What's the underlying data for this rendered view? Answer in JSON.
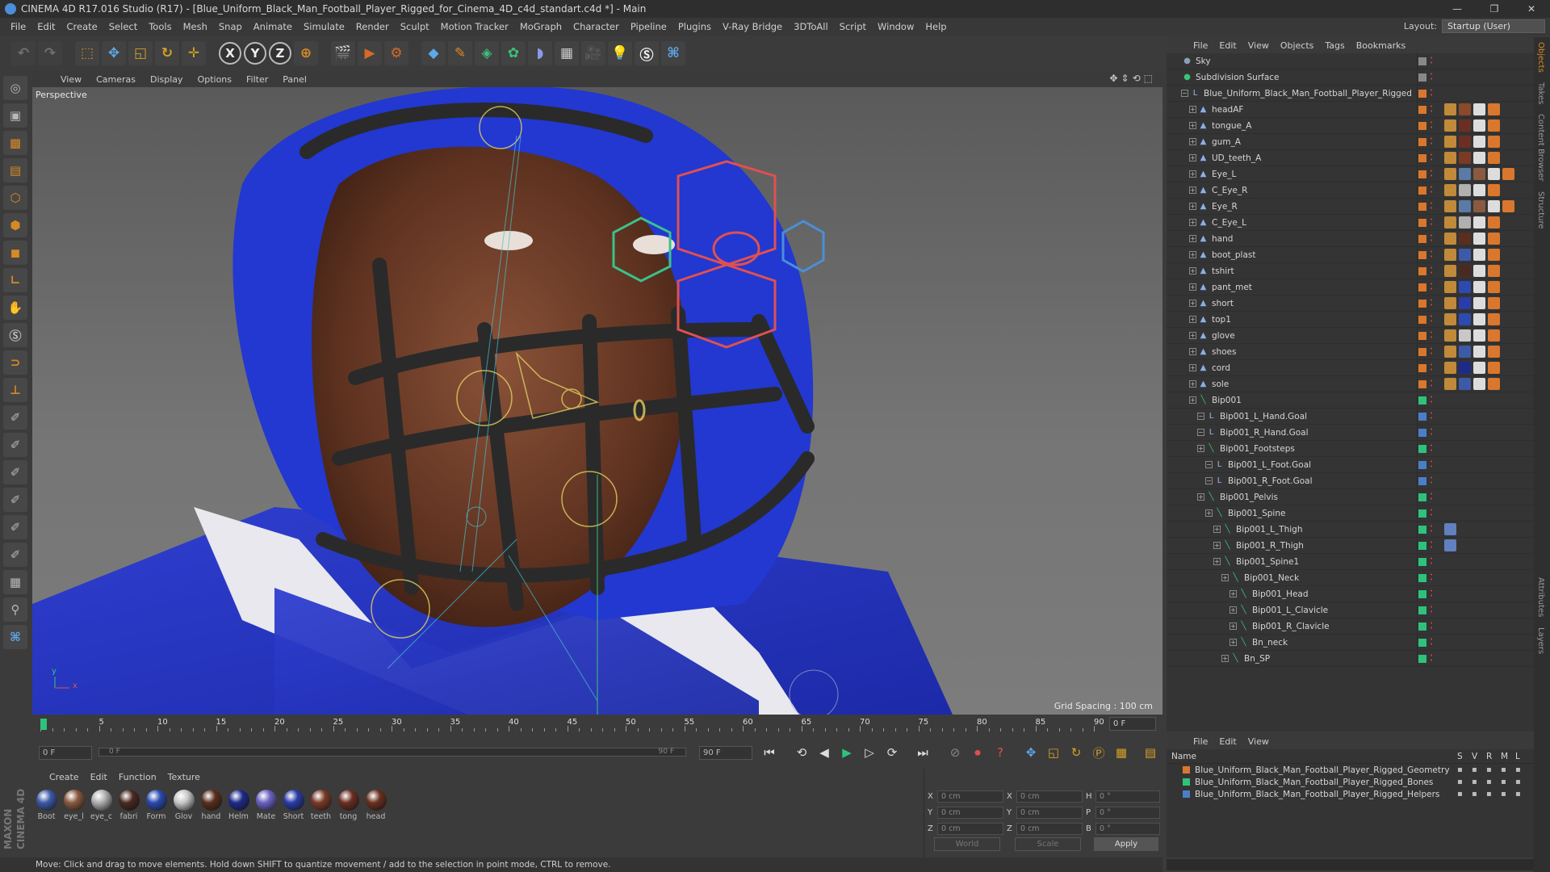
{
  "window": {
    "title": "CINEMA 4D R17.016 Studio (R17) - [Blue_Uniform_Black_Man_Football_Player_Rigged_for_Cinema_4D_c4d_standart.c4d *] - Main",
    "minimize": "—",
    "maximize": "❐",
    "close": "✕"
  },
  "menu": [
    "File",
    "Edit",
    "Create",
    "Select",
    "Tools",
    "Mesh",
    "Snap",
    "Animate",
    "Simulate",
    "Render",
    "Sculpt",
    "Motion Tracker",
    "MoGraph",
    "Character",
    "Pipeline",
    "Plugins",
    "V-Ray Bridge",
    "3DToAll",
    "Script",
    "Window",
    "Help"
  ],
  "layout": {
    "label": "Layout:",
    "value": "Startup (User)"
  },
  "toolbar": {
    "axis_x": "X",
    "axis_y": "Y",
    "axis_z": "Z"
  },
  "viewport": {
    "menu": [
      "View",
      "Cameras",
      "Display",
      "Options",
      "Filter",
      "Panel"
    ],
    "label": "Perspective",
    "grid_spacing": "Grid Spacing : 100 cm",
    "axis_y": "y",
    "axis_x": "x"
  },
  "timeline": {
    "ticks": [
      "0",
      "5",
      "10",
      "15",
      "20",
      "25",
      "30",
      "35",
      "40",
      "45",
      "50",
      "55",
      "60",
      "65",
      "70",
      "75",
      "80",
      "85",
      "90"
    ],
    "current": "0 F"
  },
  "transport": {
    "start": "0 F",
    "slider_start": "0 F",
    "slider_end": "90 F",
    "end": "90 F"
  },
  "material_menu": [
    "Create",
    "Edit",
    "Function",
    "Texture"
  ],
  "materials": [
    {
      "name": "Boot",
      "color": "#3d5aa8"
    },
    {
      "name": "eye_l",
      "color": "#8a5a40"
    },
    {
      "name": "eye_c",
      "color": "#b0b0b0"
    },
    {
      "name": "fabri",
      "color": "#4a2a20"
    },
    {
      "name": "Form",
      "color": "#2c4ab0"
    },
    {
      "name": "Glov",
      "color": "#c8c8c8"
    },
    {
      "name": "hand",
      "color": "#5a2e1e"
    },
    {
      "name": "Helm",
      "color": "#1e2a8a"
    },
    {
      "name": "Mate",
      "color": "#6a62c0"
    },
    {
      "name": "Short",
      "color": "#2a3ca8"
    },
    {
      "name": "teeth",
      "color": "#7a3a26"
    },
    {
      "name": "tong",
      "color": "#6a2e22"
    },
    {
      "name": "head",
      "color": "#6a3020"
    }
  ],
  "coords": {
    "x_pos": "0 cm",
    "y_pos": "0 cm",
    "z_pos": "0 cm",
    "x_size": "0 cm",
    "y_size": "0 cm",
    "z_size": "0 cm",
    "h": "0 °",
    "p": "0 °",
    "b": "0 °",
    "mode": "World",
    "mode2": "Scale",
    "apply": "Apply",
    "lx": "X",
    "ly": "Y",
    "lz": "Z",
    "lh": "H",
    "lp": "P",
    "lb": "B"
  },
  "status": "Move: Click and drag to move elements. Hold down SHIFT to quantize movement / add to the selection in point mode, CTRL to remove.",
  "object_manager": {
    "menu": [
      "File",
      "Edit",
      "View",
      "Objects",
      "Tags",
      "Bookmarks"
    ],
    "rows": [
      {
        "name": "Sky",
        "depth": 0,
        "icon": "sky",
        "flag": "#888888",
        "tags": []
      },
      {
        "name": "Subdivision Surface",
        "depth": 0,
        "icon": "subd",
        "flag": "#888888",
        "tags": []
      },
      {
        "name": "Blue_Uniform_Black_Man_Football_Player_Rigged",
        "depth": 1,
        "icon": "null",
        "flag": "#d9772e",
        "tags": []
      },
      {
        "name": "headAF",
        "depth": 2,
        "icon": "mesh",
        "flag": "#d9772e",
        "tags": [
          "#c08a3a",
          "#8a4a2a",
          "#dddddd",
          "#d9772e"
        ]
      },
      {
        "name": "tongue_A",
        "depth": 2,
        "icon": "mesh",
        "flag": "#d9772e",
        "tags": [
          "#c08a3a",
          "#6a2e22",
          "#dddddd",
          "#d9772e"
        ]
      },
      {
        "name": "gum_A",
        "depth": 2,
        "icon": "mesh",
        "flag": "#d9772e",
        "tags": [
          "#c08a3a",
          "#6a2e22",
          "#dddddd",
          "#d9772e"
        ]
      },
      {
        "name": "UD_teeth_A",
        "depth": 2,
        "icon": "mesh",
        "flag": "#d9772e",
        "tags": [
          "#c08a3a",
          "#7a3a26",
          "#dddddd",
          "#d9772e"
        ]
      },
      {
        "name": "Eye_L",
        "depth": 2,
        "icon": "mesh",
        "flag": "#d9772e",
        "tags": [
          "#c08a3a",
          "#5a7aa8",
          "#8a5a40",
          "#dddddd",
          "#d9772e"
        ]
      },
      {
        "name": "C_Eye_R",
        "depth": 2,
        "icon": "mesh",
        "flag": "#d9772e",
        "tags": [
          "#c08a3a",
          "#b0b0b0",
          "#dddddd",
          "#d9772e"
        ]
      },
      {
        "name": "Eye_R",
        "depth": 2,
        "icon": "mesh",
        "flag": "#d9772e",
        "tags": [
          "#c08a3a",
          "#5a7aa8",
          "#8a5a40",
          "#dddddd",
          "#d9772e"
        ]
      },
      {
        "name": "C_Eye_L",
        "depth": 2,
        "icon": "mesh",
        "flag": "#d9772e",
        "tags": [
          "#c08a3a",
          "#b0b0b0",
          "#dddddd",
          "#d9772e"
        ]
      },
      {
        "name": "hand",
        "depth": 2,
        "icon": "mesh",
        "flag": "#d9772e",
        "tags": [
          "#c08a3a",
          "#5a2e1e",
          "#dddddd",
          "#d9772e"
        ]
      },
      {
        "name": "boot_plast",
        "depth": 2,
        "icon": "mesh",
        "flag": "#d9772e",
        "tags": [
          "#c08a3a",
          "#3d5aa8",
          "#dddddd",
          "#d9772e"
        ]
      },
      {
        "name": "tshirt",
        "depth": 2,
        "icon": "mesh",
        "flag": "#d9772e",
        "tags": [
          "#c08a3a",
          "#4a2a20",
          "#dddddd",
          "#d9772e"
        ]
      },
      {
        "name": "pant_met",
        "depth": 2,
        "icon": "mesh",
        "flag": "#d9772e",
        "tags": [
          "#c08a3a",
          "#2c4ab0",
          "#dddddd",
          "#d9772e"
        ]
      },
      {
        "name": "short",
        "depth": 2,
        "icon": "mesh",
        "flag": "#d9772e",
        "tags": [
          "#c08a3a",
          "#2a3ca8",
          "#dddddd",
          "#d9772e"
        ]
      },
      {
        "name": "top1",
        "depth": 2,
        "icon": "mesh",
        "flag": "#d9772e",
        "tags": [
          "#c08a3a",
          "#2c4ab0",
          "#dddddd",
          "#d9772e"
        ]
      },
      {
        "name": "glove",
        "depth": 2,
        "icon": "mesh",
        "flag": "#d9772e",
        "tags": [
          "#c08a3a",
          "#c8c8c8",
          "#dddddd",
          "#d9772e"
        ]
      },
      {
        "name": "shoes",
        "depth": 2,
        "icon": "mesh",
        "flag": "#d9772e",
        "tags": [
          "#c08a3a",
          "#3d5aa8",
          "#dddddd",
          "#d9772e"
        ]
      },
      {
        "name": "cord",
        "depth": 2,
        "icon": "mesh",
        "flag": "#d9772e",
        "tags": [
          "#c08a3a",
          "#1e2a8a",
          "#dddddd",
          "#d9772e"
        ]
      },
      {
        "name": "sole",
        "depth": 2,
        "icon": "mesh",
        "flag": "#d9772e",
        "tags": [
          "#c08a3a",
          "#3d5aa8",
          "#dddddd",
          "#d9772e"
        ]
      },
      {
        "name": "Bip001",
        "depth": 2,
        "icon": "bone",
        "flag": "#2ec27a",
        "tags": []
      },
      {
        "name": "Bip001_L_Hand.Goal",
        "depth": 3,
        "icon": "null",
        "flag": "#4a7fc8",
        "tags": []
      },
      {
        "name": "Bip001_R_Hand.Goal",
        "depth": 3,
        "icon": "null",
        "flag": "#4a7fc8",
        "tags": []
      },
      {
        "name": "Bip001_Footsteps",
        "depth": 3,
        "icon": "bone",
        "flag": "#2ec27a",
        "tags": []
      },
      {
        "name": "Bip001_L_Foot.Goal",
        "depth": 4,
        "icon": "null",
        "flag": "#4a7fc8",
        "tags": []
      },
      {
        "name": "Bip001_R_Foot.Goal",
        "depth": 4,
        "icon": "null",
        "flag": "#4a7fc8",
        "tags": []
      },
      {
        "name": "Bip001_Pelvis",
        "depth": 3,
        "icon": "bone",
        "flag": "#2ec27a",
        "tags": []
      },
      {
        "name": "Bip001_Spine",
        "depth": 4,
        "icon": "bone",
        "flag": "#2ec27a",
        "tags": []
      },
      {
        "name": "Bip001_L_Thigh",
        "depth": 5,
        "icon": "bone",
        "flag": "#2ec27a",
        "tags": [
          "#6080c0"
        ]
      },
      {
        "name": "Bip001_R_Thigh",
        "depth": 5,
        "icon": "bone",
        "flag": "#2ec27a",
        "tags": [
          "#6080c0"
        ]
      },
      {
        "name": "Bip001_Spine1",
        "depth": 5,
        "icon": "bone",
        "flag": "#2ec27a",
        "tags": []
      },
      {
        "name": "Bip001_Neck",
        "depth": 6,
        "icon": "bone",
        "flag": "#2ec27a",
        "tags": []
      },
      {
        "name": "Bip001_Head",
        "depth": 7,
        "icon": "bone",
        "flag": "#2ec27a",
        "tags": []
      },
      {
        "name": "Bip001_L_Clavicle",
        "depth": 7,
        "icon": "bone",
        "flag": "#2ec27a",
        "tags": []
      },
      {
        "name": "Bip001_R_Clavicle",
        "depth": 7,
        "icon": "bone",
        "flag": "#2ec27a",
        "tags": []
      },
      {
        "name": "Bn_neck",
        "depth": 7,
        "icon": "bone",
        "flag": "#2ec27a",
        "tags": []
      },
      {
        "name": "Bn_SP",
        "depth": 6,
        "icon": "bone",
        "flag": "#2ec27a",
        "tags": []
      }
    ]
  },
  "layers": {
    "menu": [
      "File",
      "Edit",
      "View"
    ],
    "header": {
      "name": "Name",
      "s": "S",
      "v": "V",
      "r": "R",
      "m": "M",
      "l": "L"
    },
    "rows": [
      {
        "name": "Blue_Uniform_Black_Man_Football_Player_Rigged_Geometry",
        "color": "#d9772e"
      },
      {
        "name": "Blue_Uniform_Black_Man_Football_Player_Rigged_Bones",
        "color": "#2ec27a"
      },
      {
        "name": "Blue_Uniform_Black_Man_Football_Player_Rigged_Helpers",
        "color": "#4a7fc8"
      }
    ]
  },
  "right_tabs": [
    "Objects",
    "Takes",
    "Content Browser",
    "Structure",
    "Attributes",
    "Layers"
  ],
  "maxon": "MAXON CINEMA 4D"
}
